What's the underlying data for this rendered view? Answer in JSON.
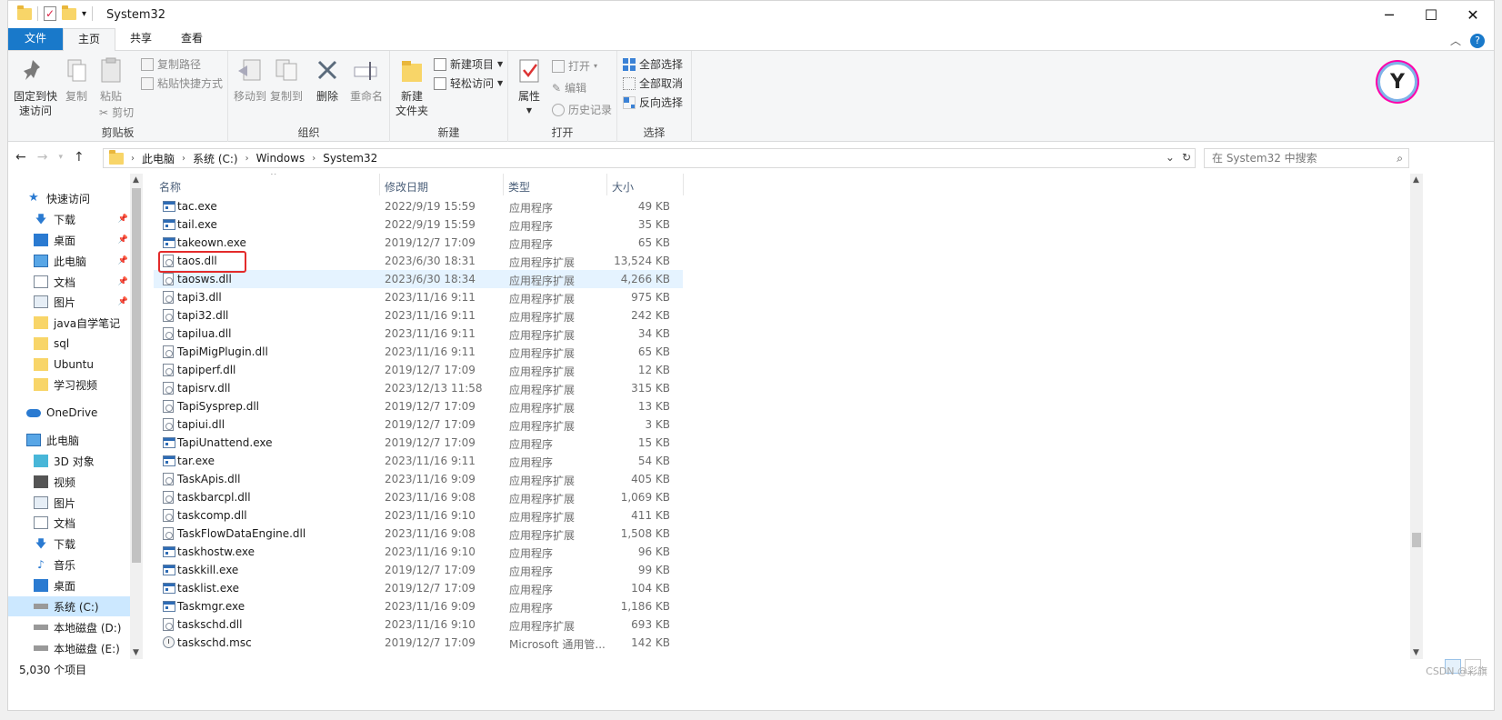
{
  "window": {
    "title": "System32"
  },
  "ribbon_tabs": [
    "文件",
    "主页",
    "共享",
    "查看"
  ],
  "clipboard": {
    "pin": "固定到快\n速访问",
    "copy": "复制",
    "paste": "粘贴",
    "copy_path": "复制路径",
    "paste_shortcut": "粘贴快捷方式",
    "cut": "剪切",
    "label": "剪贴板"
  },
  "organize": {
    "move_to": "移动到",
    "copy_to": "复制到",
    "delete": "删除",
    "rename": "重命名",
    "label": "组织"
  },
  "new": {
    "new_folder": "新建\n文件夹",
    "new_item": "新建项目",
    "easy_access": "轻松访问",
    "label": "新建"
  },
  "open": {
    "properties": "属性",
    "open": "打开",
    "edit": "编辑",
    "history": "历史记录",
    "label": "打开"
  },
  "select": {
    "select_all": "全部选择",
    "select_none": "全部取消",
    "invert": "反向选择",
    "label": "选择"
  },
  "address": {
    "crumbs": [
      "此电脑",
      "系统 (C:)",
      "Windows",
      "System32"
    ]
  },
  "search": {
    "placeholder": "在 System32 中搜索"
  },
  "sidebar": {
    "items": [
      {
        "label": "快速访问",
        "icon": "star-icon"
      },
      {
        "label": "下载",
        "icon": "download-icon",
        "pinned": true
      },
      {
        "label": "桌面",
        "icon": "desktop-icon",
        "pinned": true
      },
      {
        "label": "此电脑",
        "icon": "computer-icon",
        "pinned": true
      },
      {
        "label": "文档",
        "icon": "document-icon",
        "pinned": true
      },
      {
        "label": "图片",
        "icon": "picture-icon",
        "pinned": true
      },
      {
        "label": "java自学笔记",
        "icon": "folder-icon"
      },
      {
        "label": "sql",
        "icon": "folder-icon"
      },
      {
        "label": "Ubuntu",
        "icon": "folder-icon"
      },
      {
        "label": "学习视频",
        "icon": "folder-icon"
      },
      {
        "label": "OneDrive",
        "icon": "cloud-icon"
      },
      {
        "label": "此电脑",
        "icon": "computer-icon"
      },
      {
        "label": "3D 对象",
        "icon": "cube-icon"
      },
      {
        "label": "视频",
        "icon": "video-icon"
      },
      {
        "label": "图片",
        "icon": "picture-icon"
      },
      {
        "label": "文档",
        "icon": "document-icon"
      },
      {
        "label": "下载",
        "icon": "download-icon"
      },
      {
        "label": "音乐",
        "icon": "music-icon"
      },
      {
        "label": "桌面",
        "icon": "desktop-icon"
      },
      {
        "label": "系统 (C:)",
        "icon": "drive-icon",
        "selected": true
      },
      {
        "label": "本地磁盘 (D:)",
        "icon": "drive-icon"
      },
      {
        "label": "本地磁盘 (E:)",
        "icon": "drive-icon"
      }
    ]
  },
  "columns": {
    "name": "名称",
    "date": "修改日期",
    "type": "类型",
    "size": "大小"
  },
  "files": [
    {
      "name": "tac.exe",
      "date": "2022/9/19 15:59",
      "type": "应用程序",
      "size": "49 KB",
      "kind": "exe"
    },
    {
      "name": "tail.exe",
      "date": "2022/9/19 15:59",
      "type": "应用程序",
      "size": "35 KB",
      "kind": "exe"
    },
    {
      "name": "takeown.exe",
      "date": "2019/12/7 17:09",
      "type": "应用程序",
      "size": "65 KB",
      "kind": "exe"
    },
    {
      "name": "taos.dll",
      "date": "2023/6/30 18:31",
      "type": "应用程序扩展",
      "size": "13,524 KB",
      "kind": "dll"
    },
    {
      "name": "taosws.dll",
      "date": "2023/6/30 18:34",
      "type": "应用程序扩展",
      "size": "4,266 KB",
      "kind": "dll"
    },
    {
      "name": "tapi3.dll",
      "date": "2023/11/16 9:11",
      "type": "应用程序扩展",
      "size": "975 KB",
      "kind": "dll"
    },
    {
      "name": "tapi32.dll",
      "date": "2023/11/16 9:11",
      "type": "应用程序扩展",
      "size": "242 KB",
      "kind": "dll"
    },
    {
      "name": "tapilua.dll",
      "date": "2023/11/16 9:11",
      "type": "应用程序扩展",
      "size": "34 KB",
      "kind": "dll"
    },
    {
      "name": "TapiMigPlugin.dll",
      "date": "2023/11/16 9:11",
      "type": "应用程序扩展",
      "size": "65 KB",
      "kind": "dll"
    },
    {
      "name": "tapiperf.dll",
      "date": "2019/12/7 17:09",
      "type": "应用程序扩展",
      "size": "12 KB",
      "kind": "dll"
    },
    {
      "name": "tapisrv.dll",
      "date": "2023/12/13 11:58",
      "type": "应用程序扩展",
      "size": "315 KB",
      "kind": "dll"
    },
    {
      "name": "TapiSysprep.dll",
      "date": "2019/12/7 17:09",
      "type": "应用程序扩展",
      "size": "13 KB",
      "kind": "dll"
    },
    {
      "name": "tapiui.dll",
      "date": "2019/12/7 17:09",
      "type": "应用程序扩展",
      "size": "3 KB",
      "kind": "dll"
    },
    {
      "name": "TapiUnattend.exe",
      "date": "2019/12/7 17:09",
      "type": "应用程序",
      "size": "15 KB",
      "kind": "exe"
    },
    {
      "name": "tar.exe",
      "date": "2023/11/16 9:11",
      "type": "应用程序",
      "size": "54 KB",
      "kind": "exe"
    },
    {
      "name": "TaskApis.dll",
      "date": "2023/11/16 9:09",
      "type": "应用程序扩展",
      "size": "405 KB",
      "kind": "dll"
    },
    {
      "name": "taskbarcpl.dll",
      "date": "2023/11/16 9:08",
      "type": "应用程序扩展",
      "size": "1,069 KB",
      "kind": "dll"
    },
    {
      "name": "taskcomp.dll",
      "date": "2023/11/16 9:10",
      "type": "应用程序扩展",
      "size": "411 KB",
      "kind": "dll"
    },
    {
      "name": "TaskFlowDataEngine.dll",
      "date": "2023/11/16 9:08",
      "type": "应用程序扩展",
      "size": "1,508 KB",
      "kind": "dll"
    },
    {
      "name": "taskhostw.exe",
      "date": "2023/11/16 9:10",
      "type": "应用程序",
      "size": "96 KB",
      "kind": "exe"
    },
    {
      "name": "taskkill.exe",
      "date": "2019/12/7 17:09",
      "type": "应用程序",
      "size": "99 KB",
      "kind": "exe"
    },
    {
      "name": "tasklist.exe",
      "date": "2019/12/7 17:09",
      "type": "应用程序",
      "size": "104 KB",
      "kind": "exe"
    },
    {
      "name": "Taskmgr.exe",
      "date": "2023/11/16 9:09",
      "type": "应用程序",
      "size": "1,186 KB",
      "kind": "exe"
    },
    {
      "name": "taskschd.dll",
      "date": "2023/11/16 9:10",
      "type": "应用程序扩展",
      "size": "693 KB",
      "kind": "dll"
    },
    {
      "name": "taskschd.msc",
      "date": "2019/12/7 17:09",
      "type": "Microsoft 通用管...",
      "size": "142 KB",
      "kind": "msc"
    }
  ],
  "status": {
    "count": "5,030 个项目"
  },
  "watermark": "CSDN @彩旗"
}
